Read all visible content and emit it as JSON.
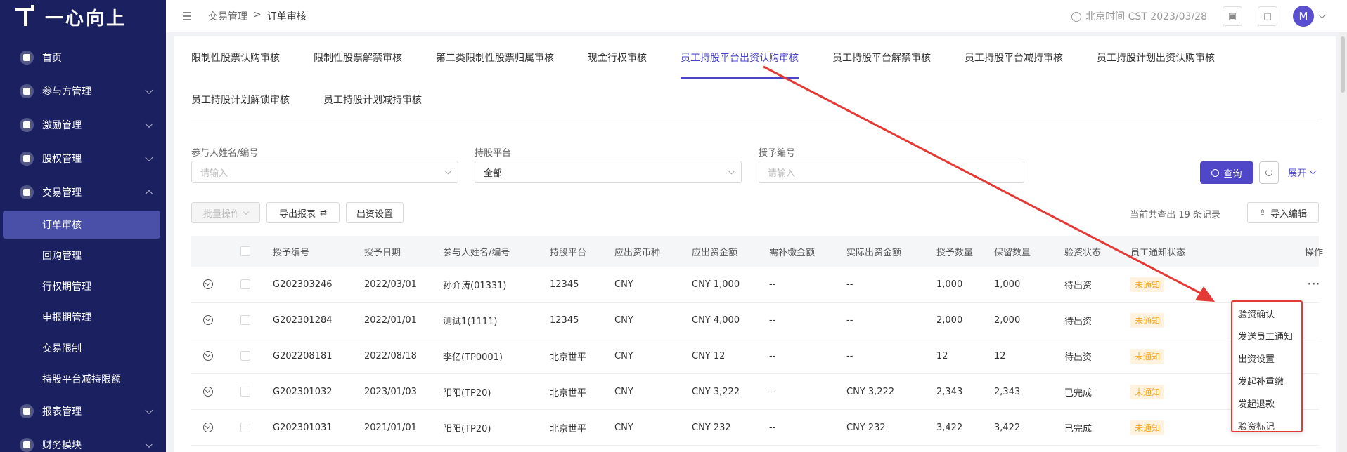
{
  "app": {
    "logo_text": "一心向上"
  },
  "sidebar": {
    "items": [
      {
        "label": "首页"
      },
      {
        "label": "参与方管理"
      },
      {
        "label": "激励管理"
      },
      {
        "label": "股权管理"
      },
      {
        "label": "交易管理"
      }
    ],
    "sub_items": [
      {
        "label": "订单审核"
      },
      {
        "label": "回购管理"
      },
      {
        "label": "行权期管理"
      },
      {
        "label": "申报期管理"
      },
      {
        "label": "交易限制"
      },
      {
        "label": "持股平台减持限额"
      }
    ],
    "bottom_items": [
      {
        "label": "报表管理"
      },
      {
        "label": "财务模块"
      }
    ]
  },
  "header": {
    "breadcrumb": [
      "交易管理",
      "订单审核"
    ],
    "separator": ">",
    "time_text": "北京时间 CST 2023/03/28",
    "avatar": "M"
  },
  "tabs": [
    {
      "label": "限制性股票认购审核"
    },
    {
      "label": "限制性股票解禁审核"
    },
    {
      "label": "第二类限制性股票归属审核"
    },
    {
      "label": "现金行权审核"
    },
    {
      "label": "员工持股平台出资认购审核"
    },
    {
      "label": "员工持股平台解禁审核"
    },
    {
      "label": "员工持股平台减持审核"
    },
    {
      "label": "员工持股计划出资认购审核"
    },
    {
      "label": "员工持股计划解锁审核"
    },
    {
      "label": "员工持股计划减持审核"
    }
  ],
  "filters": {
    "participant_label": "参与人姓名/编号",
    "participant_placeholder": "请输入",
    "platform_label": "持股平台",
    "platform_value": "全部",
    "grant_label": "授予编号",
    "grant_placeholder": "请输入",
    "query_label": "查询",
    "expand_label": "展开"
  },
  "toolbar": {
    "batch_label": "批量操作",
    "export_label": "导出报表",
    "fund_label": "出资设置",
    "count_text": "当前共查出 19 条记录",
    "import_label": "导入编辑"
  },
  "table": {
    "headers": [
      "授予编号",
      "授予日期",
      "参与人姓名/编号",
      "持股平台",
      "应出资币种",
      "应出资金额",
      "需补缴金额",
      "实际出资金额",
      "授予数量",
      "保留数量",
      "验资状态",
      "员工通知状态",
      "操作"
    ],
    "rows": [
      [
        "G202303246",
        "2022/03/01",
        "孙介涛(01331)",
        "12345",
        "CNY",
        "CNY 1,000",
        "--",
        "--",
        "1,000",
        "1,000",
        "待出资",
        "未通知"
      ],
      [
        "G202301284",
        "2022/01/01",
        "测试1(1111)",
        "12345",
        "CNY",
        "CNY 4,000",
        "--",
        "--",
        "2,000",
        "2,000",
        "待出资",
        "未通知"
      ],
      [
        "G202208181",
        "2022/08/18",
        "李亿(TP0001)",
        "北京世平",
        "CNY",
        "CNY 12",
        "--",
        "--",
        "12",
        "12",
        "待出资",
        "未通知"
      ],
      [
        "G202301032",
        "2023/01/03",
        "阳阳(TP20)",
        "北京世平",
        "CNY",
        "CNY 3,222",
        "--",
        "CNY 3,222",
        "2,343",
        "2,343",
        "已完成",
        "未通知"
      ],
      [
        "G202301031",
        "2021/01/01",
        "阳阳(TP20)",
        "北京世平",
        "CNY",
        "CNY 232",
        "--",
        "CNY 232",
        "3,422",
        "3,422",
        "已完成",
        "未通知"
      ]
    ],
    "more_label": "···"
  },
  "dropdown": {
    "items": [
      "验资确认",
      "发送员工通知",
      "出资设置",
      "发起补重缴",
      "发起退款",
      "验资标记"
    ]
  },
  "colors": {
    "sidebar_bg": "#1b2160",
    "accent": "#4a44c6",
    "annotation": "#e53935",
    "badge_text": "#f5a623"
  }
}
